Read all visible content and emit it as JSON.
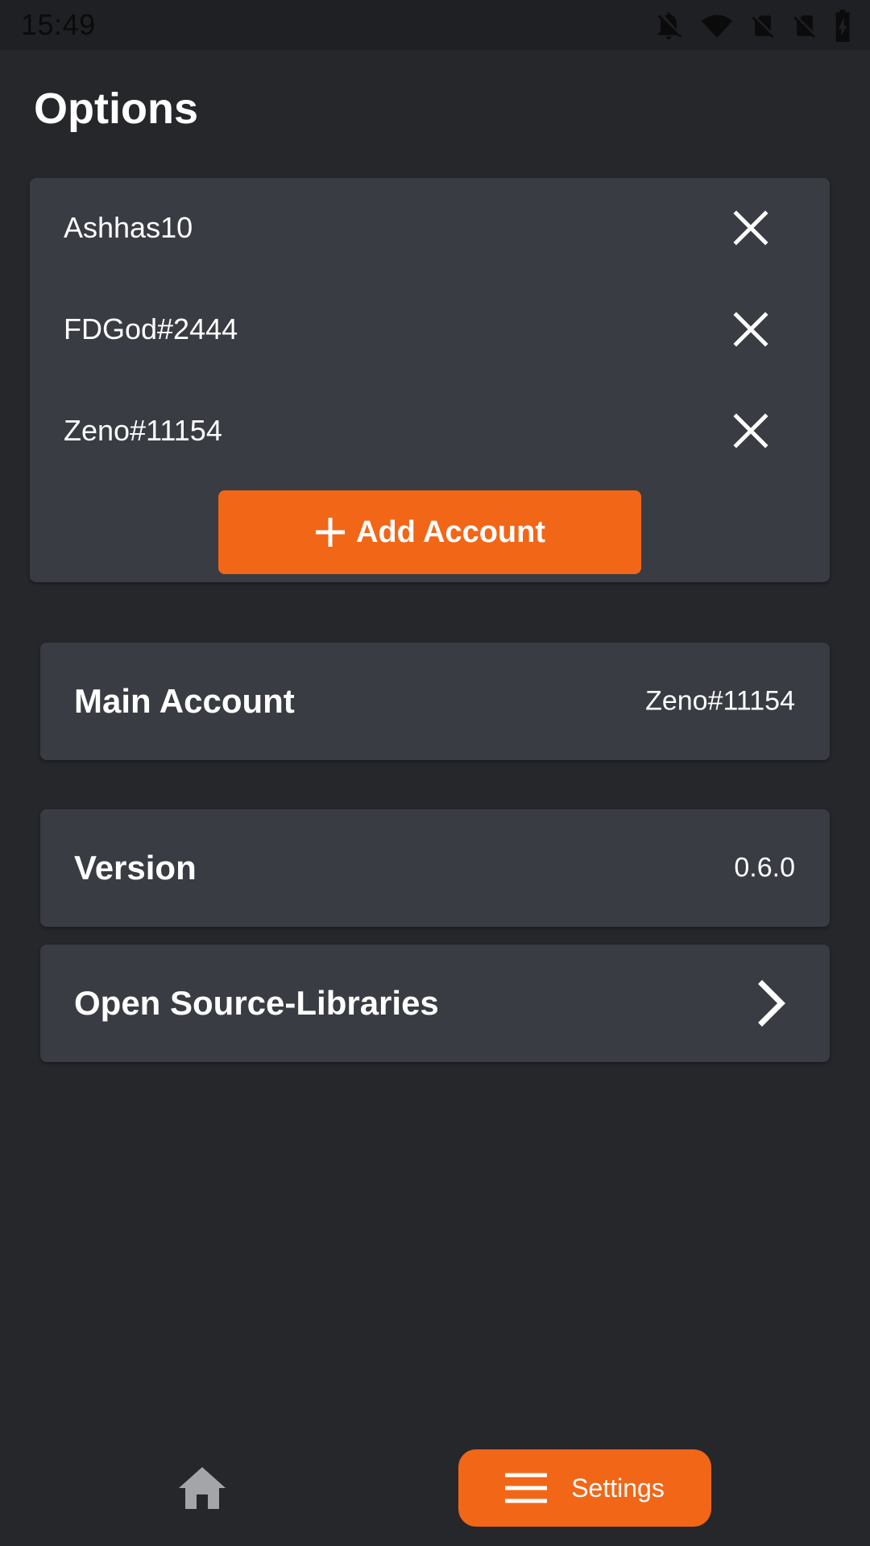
{
  "status_bar": {
    "time": "15:49",
    "icons": [
      "notifications-off-icon",
      "wifi-icon",
      "no-sim-icon",
      "no-sim-icon",
      "battery-charging-icon"
    ]
  },
  "page": {
    "title": "Options"
  },
  "accounts": {
    "items": [
      {
        "name": "Ashhas10",
        "remove_icon": "close-icon"
      },
      {
        "name": "FDGod#2444",
        "remove_icon": "close-icon"
      },
      {
        "name": "Zeno#11154",
        "remove_icon": "close-icon"
      }
    ],
    "add_button": {
      "label": "Add Account",
      "icon": "plus-icon"
    }
  },
  "main_account": {
    "label": "Main Account",
    "value": "Zeno#11154"
  },
  "version": {
    "label": "Version",
    "value": "0.6.0"
  },
  "open_source": {
    "label": "Open Source-Libraries",
    "icon": "chevron-right-icon"
  },
  "bottom_nav": {
    "home_icon": "home-icon",
    "settings": {
      "label": "Settings",
      "icon": "menu-icon"
    }
  },
  "colors": {
    "background": "#26272b",
    "card": "#393c42",
    "accent": "#f26617",
    "status_bar": "#1f2023"
  }
}
